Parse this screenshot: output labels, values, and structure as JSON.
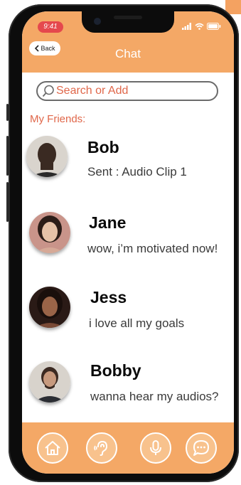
{
  "status_bar": {
    "time": "9:41"
  },
  "header": {
    "back_label": "Back",
    "title": "Chat"
  },
  "search": {
    "placeholder": "Search or Add"
  },
  "friends_section": {
    "label": "My Friends:"
  },
  "friends": [
    {
      "name": "Bob",
      "message": "Sent : Audio Clip 1"
    },
    {
      "name": "Jane",
      "message": "wow, i’m motivated now!"
    },
    {
      "name": "Jess",
      "message": "i love all my goals"
    },
    {
      "name": "Bobby",
      "message": "wanna hear my audios?"
    }
  ],
  "bottom_nav": {
    "items": [
      {
        "icon": "home-icon"
      },
      {
        "icon": "ear-icon"
      },
      {
        "icon": "microphone-icon"
      },
      {
        "icon": "chat-bubble-icon"
      }
    ]
  },
  "colors": {
    "accent": "#f4a866",
    "label": "#e0674a",
    "time_pill": "#e5484d"
  }
}
